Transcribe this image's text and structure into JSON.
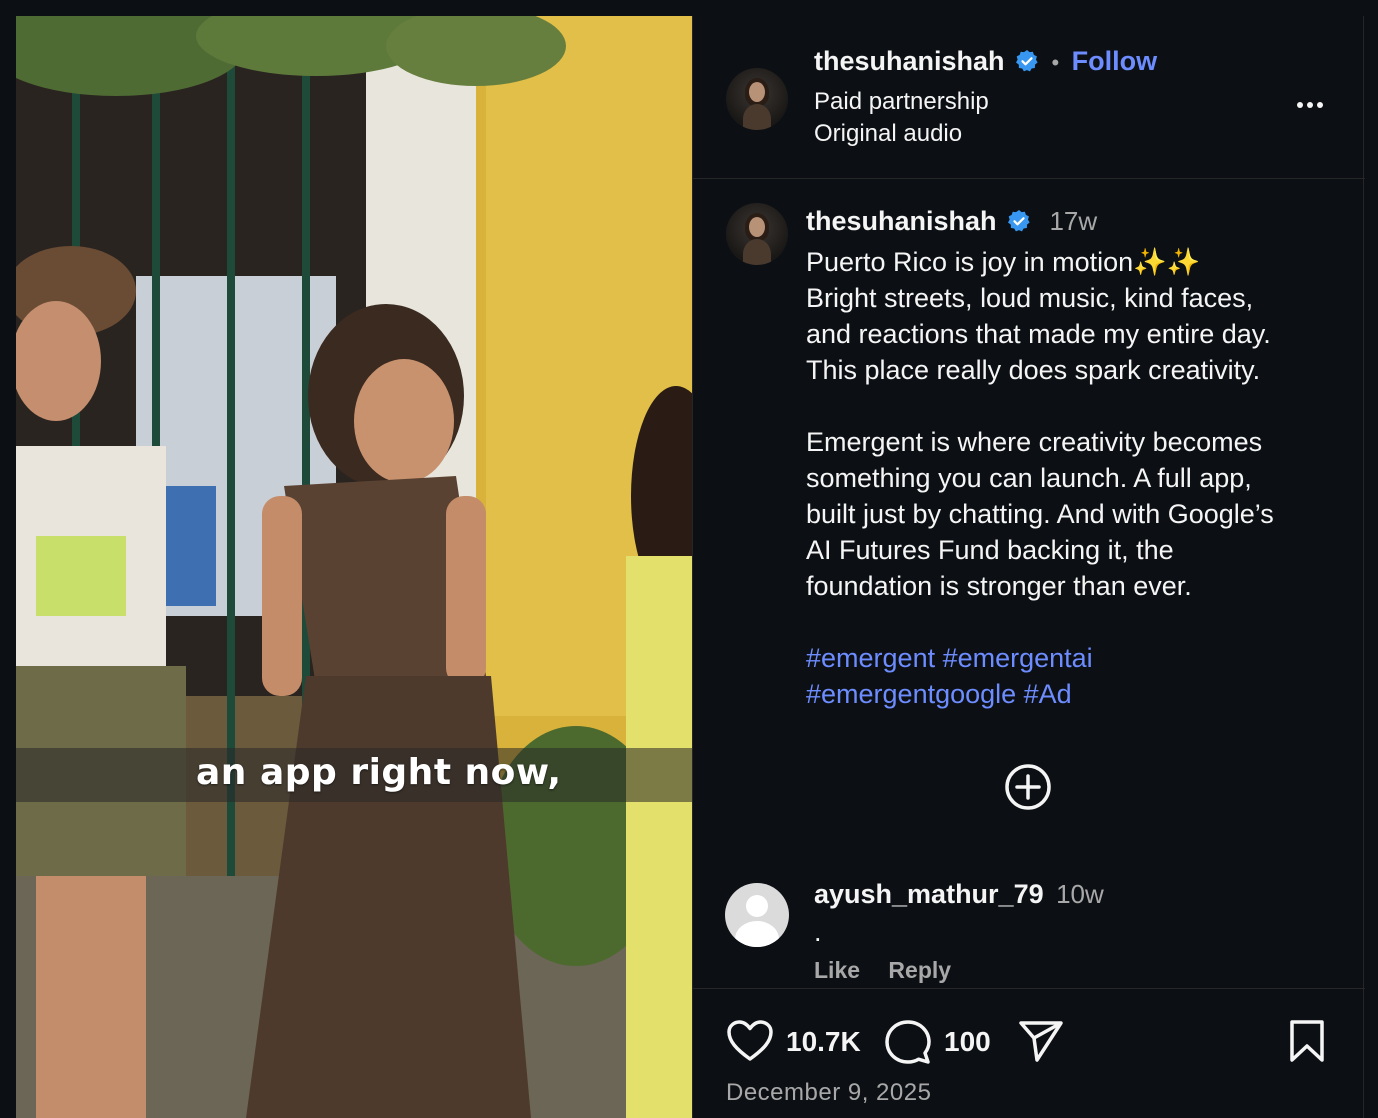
{
  "media": {
    "overlay_caption": "an app right now,"
  },
  "header": {
    "username": "thesuhanishah",
    "verified": true,
    "separator": "•",
    "follow_label": "Follow",
    "line1": "Paid partnership",
    "line2": "Original audio",
    "more_icon": "more-horizontal-icon"
  },
  "post": {
    "username": "thesuhanishah",
    "age": "17w",
    "caption_lines": [
      "Puerto Rico is joy in motion✨✨",
      "Bright streets, loud music, kind faces,",
      "and reactions that made my entire day.",
      "This place really does spark creativity.",
      "",
      "Emergent is where creativity becomes",
      "something you can launch. A full app,",
      "built just by chatting. And with Google’s",
      "AI Futures Fund backing it, the",
      "foundation is stronger than ever."
    ],
    "hashtags_line1": "#emergent #emergentai",
    "hashtags_line2": "#emergentgoogle #Ad",
    "load_more_icon": "plus-circle-icon"
  },
  "comment": {
    "username": "ayush_mathur_79",
    "age": "10w",
    "text": ".",
    "like_label": "Like",
    "reply_label": "Reply"
  },
  "actions": {
    "likes": "10.7K",
    "comments": "100",
    "date": "December 9, 2025"
  },
  "colors": {
    "background": "#0c1014",
    "link_blue": "#6d8cff",
    "verified_blue": "#3897f0",
    "muted": "#a8a8a8"
  }
}
